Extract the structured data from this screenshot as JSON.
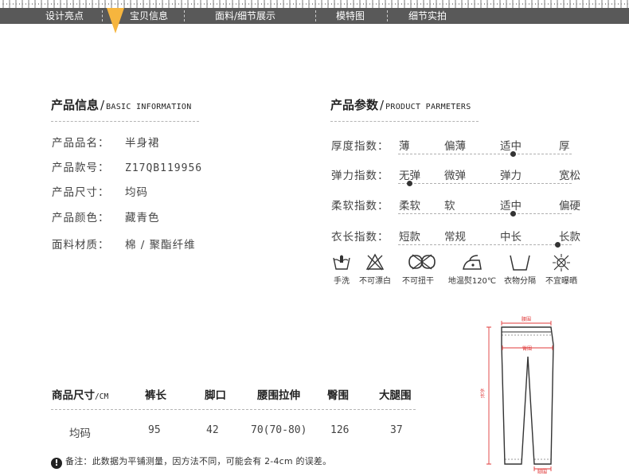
{
  "nav": {
    "items": [
      "设计亮点",
      "宝贝信息",
      "面料/细节展示",
      "模特图",
      "细节实拍"
    ],
    "active": "宝贝信息",
    "marker_color": "#f6b53e",
    "bar_color": "#595959"
  },
  "product_info": {
    "title_cn": "产品信息",
    "title_en": "BASIC INFORMATION",
    "rows": [
      {
        "label": "产品品名：",
        "value": "半身裙"
      },
      {
        "label": "产品款号：",
        "value": "Z17QB119956"
      },
      {
        "label": "产品尺寸：",
        "value": "均码"
      },
      {
        "label": "产品颜色：",
        "value": "藏青色"
      },
      {
        "label": "面料材质：",
        "value": "棉 / 聚酯纤维"
      }
    ]
  },
  "product_params": {
    "title_cn": "产品参数",
    "title_en": "PRODUCT PARMETERS",
    "rows": [
      {
        "label": "厚度指数：",
        "options": [
          "薄",
          "偏薄",
          "适中",
          "厚"
        ],
        "selected_index": 2
      },
      {
        "label": "弹力指数：",
        "options": [
          "无弹",
          "微弹",
          "弹力",
          "宽松"
        ],
        "selected_index": 0
      },
      {
        "label": "柔软指数：",
        "options": [
          "柔软",
          "软",
          "适中",
          "偏硬"
        ],
        "selected_index": 2
      },
      {
        "label": "衣长指数：",
        "options": [
          "短款",
          "常规",
          "中长",
          "长款"
        ],
        "selected_index": 3
      }
    ]
  },
  "care_labels": [
    {
      "icon": "hand-wash-icon",
      "label": "手洗"
    },
    {
      "icon": "no-bleach-icon",
      "label": "不可漂白"
    },
    {
      "icon": "no-wring-icon",
      "label": "不可扭干"
    },
    {
      "icon": "iron-low-temp-icon",
      "label": "地温熨120℃"
    },
    {
      "icon": "wash-separately-icon",
      "label": "衣物分隔"
    },
    {
      "icon": "no-sun-dry-icon",
      "label": "不宜曝晒"
    }
  ],
  "size_table": {
    "headers": [
      "商品尺寸",
      "裤长",
      "脚口",
      "腰围拉伸",
      "臀围",
      "大腿围"
    ],
    "unit": "/CM",
    "rows": [
      [
        "均码",
        "95",
        "42",
        "70(70-80)",
        "126",
        "37"
      ]
    ]
  },
  "note": {
    "icon": "exclamation-icon",
    "text": "备注：此数据为平铺测量，因方法不同，可能会有 2-4cm 的误差。"
  },
  "diagram": {
    "labels": {
      "waist": "腰围",
      "hip": "臀围",
      "length": "外长",
      "hem": "脚围"
    },
    "measure_color": "#e03a3a"
  }
}
